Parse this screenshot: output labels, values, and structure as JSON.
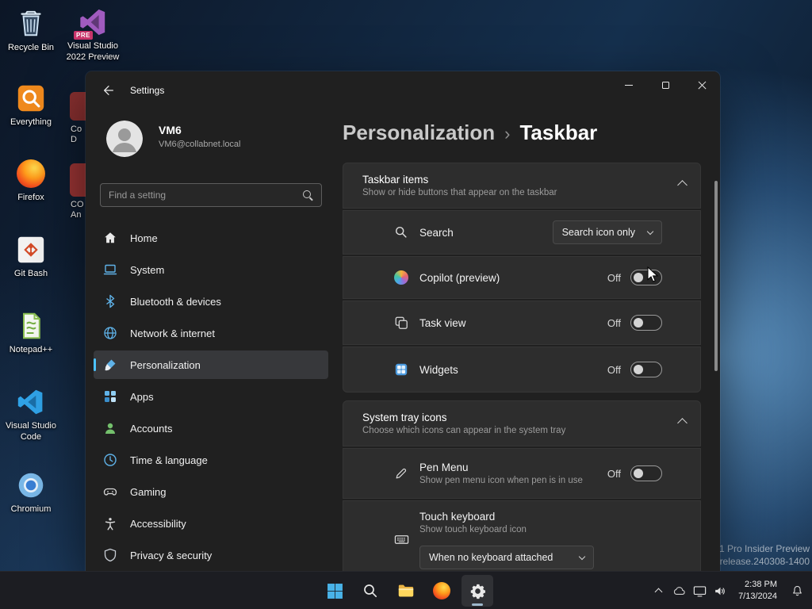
{
  "desktop": {
    "icons_col1": [
      {
        "label": "Recycle Bin",
        "icon": "recycle-bin-icon"
      },
      {
        "label": "Everything",
        "icon": "everything-icon"
      },
      {
        "label": "Firefox",
        "icon": "firefox-icon"
      },
      {
        "label": "Git Bash",
        "icon": "git-bash-icon"
      },
      {
        "label": "Notepad++",
        "icon": "notepad-plus-plus-icon"
      },
      {
        "label": "Visual Studio Code",
        "icon": "visual-studio-code-icon"
      },
      {
        "label": "Chromium",
        "icon": "chromium-icon"
      }
    ],
    "icons_col2": [
      {
        "label": "Visual Studio 2022 Preview",
        "badge": "PRE",
        "icon": "visual-studio-2022-icon"
      },
      {
        "label_lines": [
          "Co",
          "D"
        ],
        "icon": "hidden-app-icon"
      },
      {
        "label_lines": [
          "CO",
          "An"
        ],
        "icon": "hidden-app-icon"
      }
    ],
    "watermark_lines": [
      "1 Pro Insider Preview",
      "_release.240308-1400"
    ]
  },
  "settings": {
    "title": "Settings",
    "window_controls": [
      "minimize-icon",
      "maximize-icon",
      "close-icon"
    ],
    "back_icon": "back-arrow-icon",
    "user": {
      "name": "VM6",
      "email": "VM6@collabnet.local"
    },
    "search": {
      "placeholder": "Find a setting",
      "icon": "search-icon"
    },
    "nav": [
      {
        "label": "Home",
        "icon": "home-icon"
      },
      {
        "label": "System",
        "icon": "system-laptop-icon"
      },
      {
        "label": "Bluetooth & devices",
        "icon": "bluetooth-icon"
      },
      {
        "label": "Network & internet",
        "icon": "network-globe-icon"
      },
      {
        "label": "Personalization",
        "icon": "personalization-brush-icon",
        "selected": true
      },
      {
        "label": "Apps",
        "icon": "apps-grid-icon"
      },
      {
        "label": "Accounts",
        "icon": "accounts-person-icon"
      },
      {
        "label": "Time & language",
        "icon": "time-language-clock-icon"
      },
      {
        "label": "Gaming",
        "icon": "gaming-controller-icon"
      },
      {
        "label": "Accessibility",
        "icon": "accessibility-icon"
      },
      {
        "label": "Privacy & security",
        "icon": "privacy-shield-icon"
      }
    ],
    "breadcrumb": {
      "parent": "Personalization",
      "separator": "›",
      "current": "Taskbar"
    },
    "sections": {
      "taskbar_items": {
        "title": "Taskbar items",
        "subtitle": "Show or hide buttons that appear on the taskbar",
        "expander_icon": "chevron-up-icon",
        "rows": [
          {
            "label": "Search",
            "icon": "search-magnifier-icon",
            "control": "dropdown",
            "value": "Search icon only"
          },
          {
            "label": "Copilot (preview)",
            "icon": "copilot-icon",
            "control": "toggle",
            "state": "Off"
          },
          {
            "label": "Task view",
            "icon": "task-view-icon",
            "control": "toggle",
            "state": "Off"
          },
          {
            "label": "Widgets",
            "icon": "widgets-icon",
            "control": "toggle",
            "state": "Off"
          }
        ]
      },
      "system_tray": {
        "title": "System tray icons",
        "subtitle": "Choose which icons can appear in the system tray",
        "expander_icon": "chevron-up-icon",
        "rows": [
          {
            "label": "Pen Menu",
            "description": "Show pen menu icon when pen is in use",
            "icon": "pen-icon",
            "control": "toggle",
            "state": "Off"
          },
          {
            "label": "Touch keyboard",
            "description": "Show touch keyboard icon",
            "icon": "touch-keyboard-icon",
            "control": "dropdown",
            "value": "When no keyboard attached"
          }
        ]
      }
    }
  },
  "taskbar": {
    "buttons": [
      {
        "name": "Start",
        "icon": "windows-start-icon"
      },
      {
        "name": "Search",
        "icon": "taskbar-search-icon"
      },
      {
        "name": "File Explorer",
        "icon": "file-explorer-icon"
      },
      {
        "name": "Firefox",
        "icon": "firefox-taskbar-icon"
      },
      {
        "name": "Settings",
        "icon": "settings-gear-icon",
        "active": true
      }
    ],
    "tray": {
      "icons": [
        "chevron-up-icon",
        "onedrive-cloud-icon",
        "display-icon",
        "volume-icon"
      ],
      "time": "2:38 PM",
      "date": "7/13/2024",
      "notification_icon": "bell-icon"
    }
  }
}
